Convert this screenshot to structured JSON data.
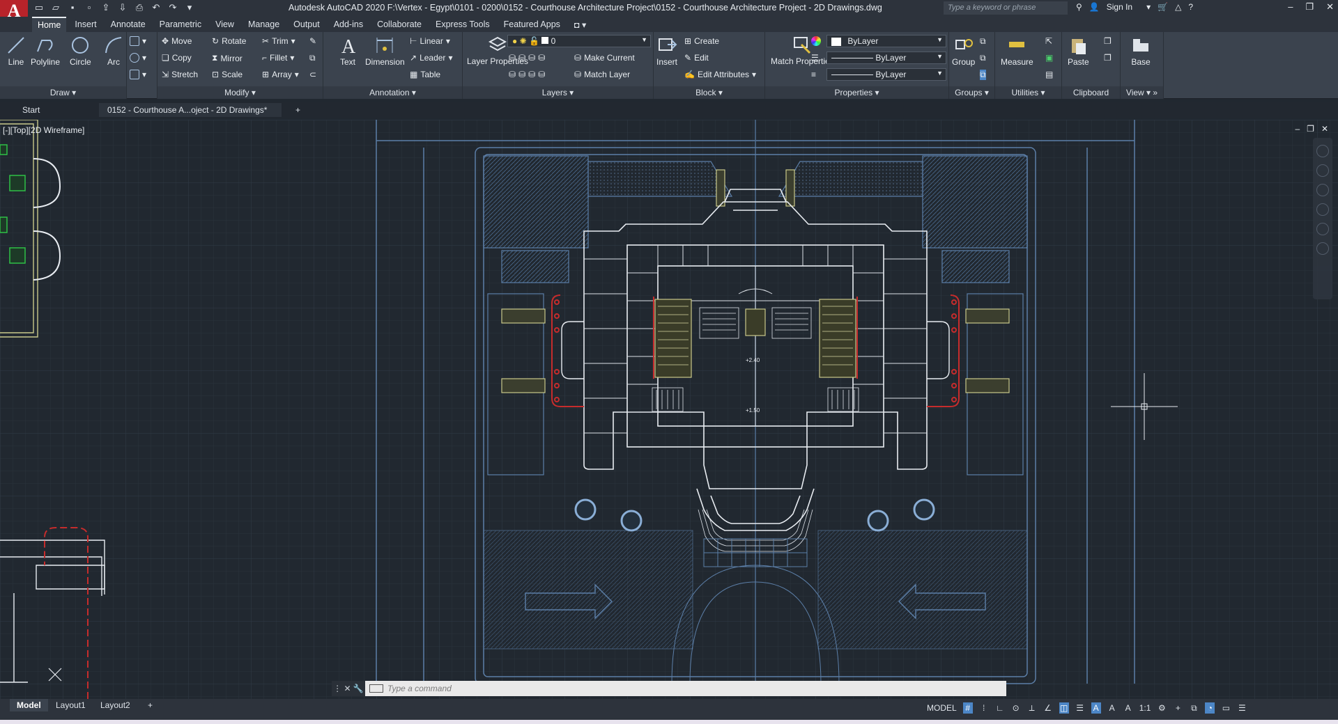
{
  "app": {
    "title": "Autodesk AutoCAD 2020    F:\\Vertex - Egypt\\0101 - 0200\\0152 - Courthouse Architecture Project\\0152 - Courthouse Architecture Project - 2D Drawings.dwg",
    "logo_letter": "A",
    "search_placeholder": "Type a keyword or phrase",
    "sign_in": "Sign In"
  },
  "ribbon_tabs": [
    "Home",
    "Insert",
    "Annotate",
    "Parametric",
    "View",
    "Manage",
    "Output",
    "Add-ins",
    "Collaborate",
    "Express Tools",
    "Featured Apps"
  ],
  "draw": {
    "title": "Draw",
    "line": "Line",
    "polyline": "Polyline",
    "circle": "Circle",
    "arc": "Arc"
  },
  "modify": {
    "title": "Modify",
    "move": "Move",
    "rotate": "Rotate",
    "trim": "Trim",
    "copy": "Copy",
    "mirror": "Mirror",
    "fillet": "Fillet",
    "stretch": "Stretch",
    "scale": "Scale",
    "array": "Array"
  },
  "annotation": {
    "title": "Annotation",
    "text": "Text",
    "dimension": "Dimension",
    "linear": "Linear",
    "leader": "Leader",
    "table": "Table"
  },
  "layers": {
    "title": "Layers",
    "layer_properties": "Layer Properties",
    "current_layer": "0",
    "make_current": "Make Current",
    "match_layer": "Match Layer"
  },
  "block": {
    "title": "Block",
    "insert": "Insert",
    "create": "Create",
    "edit": "Edit",
    "edit_attributes": "Edit Attributes"
  },
  "properties": {
    "title": "Properties",
    "match_properties": "Match Properties",
    "color": "ByLayer",
    "linetype": "ByLayer",
    "lineweight": "ByLayer"
  },
  "groups": {
    "title": "Groups",
    "group": "Group"
  },
  "utilities": {
    "title": "Utilities",
    "measure": "Measure"
  },
  "clipboard": {
    "title": "Clipboard",
    "paste": "Paste"
  },
  "view_panel": {
    "title": "View",
    "base": "Base"
  },
  "file_tabs": {
    "start": "Start",
    "active": "0152 - Courthouse A...oject - 2D Drawings*"
  },
  "viewport": {
    "label": "[-][Top][2D Wireframe]"
  },
  "drawing": {
    "level_a": "+2.40",
    "level_b": "+1.50"
  },
  "command": {
    "placeholder": "Type a command"
  },
  "layouts": [
    "Model",
    "Layout1",
    "Layout2"
  ],
  "status": {
    "model": "MODEL",
    "scale": "1:1"
  },
  "colors": {
    "bg": "#212830",
    "ribbon": "#3b434e",
    "cad_blue": "#5c7fa8",
    "cad_white": "#e9edf2",
    "cad_yellow": "#c9c98a",
    "cad_red": "#c62c2c",
    "cad_green": "#2fbf47"
  }
}
